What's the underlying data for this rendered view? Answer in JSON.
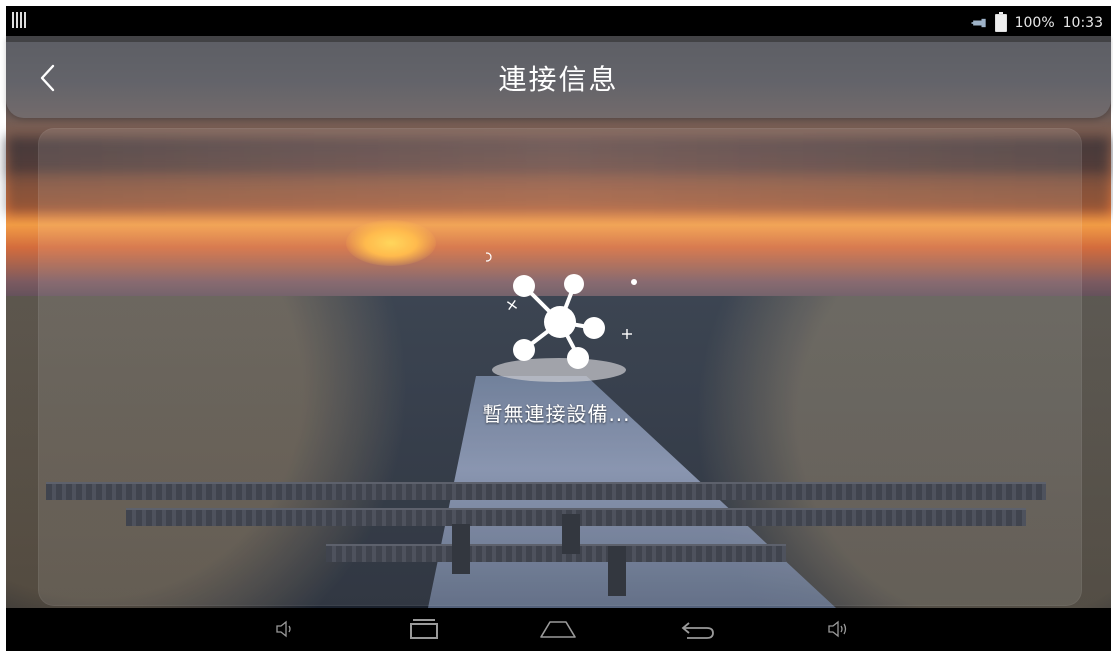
{
  "status_bar": {
    "battery": "100%",
    "time": "10:33",
    "icons": [
      "signal-bars-icon",
      "usb-icon",
      "battery-charging-icon"
    ]
  },
  "header": {
    "title": "連接信息",
    "back_icon": "chevron-left-icon"
  },
  "main": {
    "empty_state_text": "暫無連接設備...",
    "hub_icon": "device-network-hub-icon"
  },
  "nav_bar": {
    "buttons": [
      "volume-down-icon",
      "recent-apps-icon",
      "home-icon",
      "back-icon",
      "volume-up-icon"
    ]
  },
  "colors": {
    "header_overlay": "#78787d",
    "panel_overlay": "#ffffff",
    "title_text": "#ffffff"
  }
}
